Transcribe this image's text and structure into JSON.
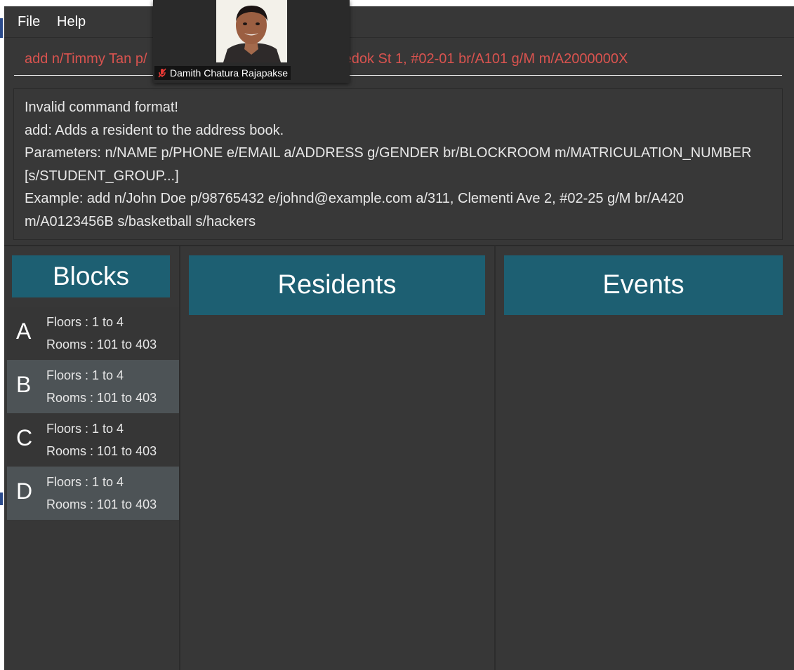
{
  "menu": {
    "file": "File",
    "help": "Help"
  },
  "command": {
    "value": "add n/Timmy Tan p/                              n a/Blk 10, Bedok St 1, #02-01 br/A101 g/M m/A2000000X"
  },
  "result": {
    "lines": [
      "Invalid command format!",
      "add: Adds a resident to the address book.",
      "Parameters: n/NAME p/PHONE e/EMAIL a/ADDRESS g/GENDER br/BLOCKROOM m/MATRICULATION_NUMBER",
      "[s/STUDENT_GROUP...]",
      "Example: add n/John Doe p/98765432 e/johnd@example.com a/311, Clementi Ave 2, #02-25 g/M br/A420",
      "m/A0123456B s/basketball s/hackers"
    ]
  },
  "panels": {
    "blocks": "Blocks",
    "residents": "Residents",
    "events": "Events"
  },
  "blocks": [
    {
      "letter": "A",
      "floors": "Floors : 1 to 4",
      "rooms": "Rooms : 101 to 403"
    },
    {
      "letter": "B",
      "floors": "Floors : 1 to 4",
      "rooms": "Rooms : 101 to 403"
    },
    {
      "letter": "C",
      "floors": "Floors : 1 to 4",
      "rooms": "Rooms : 101 to 403"
    },
    {
      "letter": "D",
      "floors": "Floors : 1 to 4",
      "rooms": "Rooms : 101 to 403"
    }
  ],
  "video": {
    "name": "Damith Chatura Rajapakse"
  },
  "colors": {
    "panel_header": "#1d5f72",
    "background": "#373737",
    "error_text": "#d9534f",
    "card_alt": "#4d5356"
  }
}
